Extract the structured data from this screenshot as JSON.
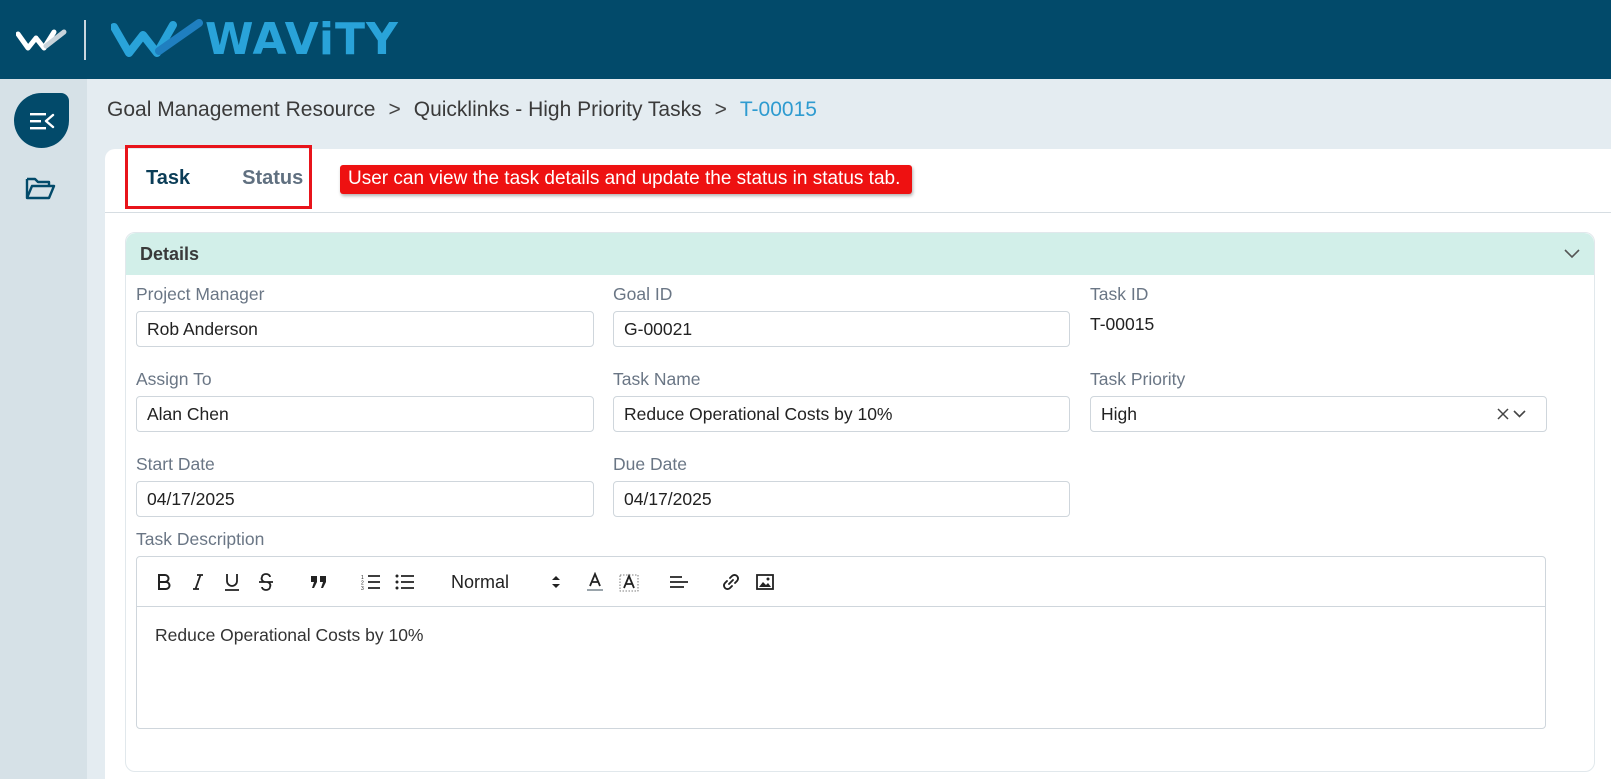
{
  "header": {
    "brand": "WAViTY",
    "colors": {
      "header_bg": "#024a6a",
      "brand_blue": "#29a3d9",
      "tab_highlight": "#e8141b"
    }
  },
  "rail": {
    "toggle_icon": "menu-collapse-icon",
    "folder_icon": "folder-open-icon"
  },
  "breadcrumb": {
    "items": [
      "Goal Management Resource",
      "Quicklinks - High Priority Tasks",
      "T-00015"
    ],
    "separator": ">"
  },
  "tabs": [
    {
      "label": "Task",
      "active": true
    },
    {
      "label": "Status",
      "active": false
    }
  ],
  "annotation": "User can view the task details and update the status in status tab.",
  "details": {
    "title": "Details",
    "fields": {
      "project_manager": {
        "label": "Project Manager",
        "value": "Rob Anderson"
      },
      "goal_id": {
        "label": "Goal ID",
        "value": "G-00021"
      },
      "task_id": {
        "label": "Task ID",
        "value": "T-00015"
      },
      "assign_to": {
        "label": "Assign To",
        "value": "Alan Chen"
      },
      "task_name": {
        "label": "Task Name",
        "value": "Reduce Operational Costs by 10%"
      },
      "task_priority": {
        "label": "Task Priority",
        "value": "High"
      },
      "start_date": {
        "label": "Start Date",
        "value": "04/17/2025"
      },
      "due_date": {
        "label": "Due Date",
        "value": "04/17/2025"
      },
      "task_description": {
        "label": "Task Description",
        "value": "Reduce Operational Costs by 10%"
      }
    },
    "editor": {
      "font_size_option": "Normal"
    }
  }
}
